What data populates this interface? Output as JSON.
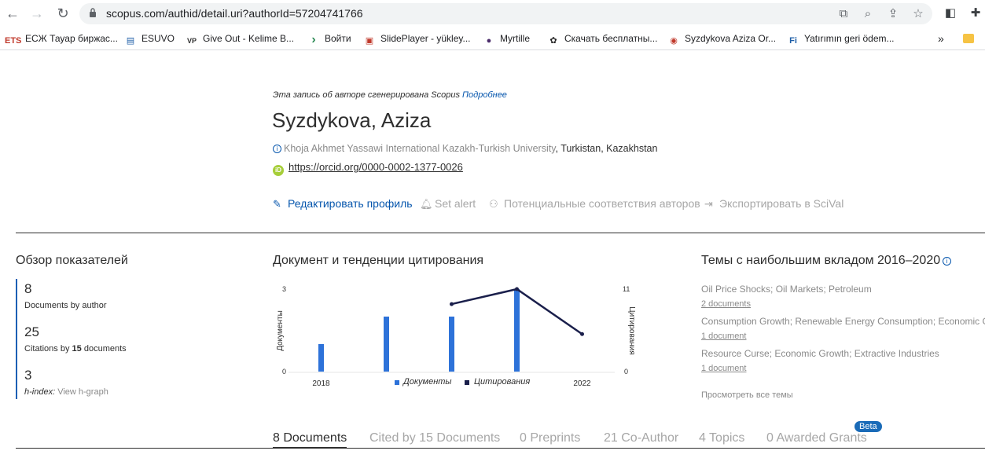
{
  "browser": {
    "url": "scopus.com/authid/detail.uri?authorId=57204741766",
    "bookmarks": [
      {
        "fav": "ETS",
        "label": "ЕСЖ Тауар биржас...",
        "color": "#c0392b"
      },
      {
        "fav": "▤",
        "label": "ESUVO",
        "color": "#1f5fa8"
      },
      {
        "fav": "VP",
        "label": "Give Out - Kelime B...",
        "color": "#333333"
      },
      {
        "fav": "›",
        "label": "Войти",
        "color": "#2e8b57"
      },
      {
        "fav": "▣",
        "label": "SlidePlayer - yükley...",
        "color": "#c0392b"
      },
      {
        "fav": "●",
        "label": "Myrtille",
        "color": "#4b2c6b"
      },
      {
        "fav": "✿",
        "label": "Скачать бесплатны...",
        "color": "#222222"
      },
      {
        "fav": "◉",
        "label": "Syzdykova Aziza Or...",
        "color": "#c0392b"
      },
      {
        "fav": "Fi",
        "label": "Yatırımın geri ödem...",
        "color": "#1f5fa8"
      }
    ],
    "more_label": "»"
  },
  "author": {
    "note_text": "Эта запись об авторе сгенерирована Scopus",
    "note_link": "Подробнее",
    "name": "Syzdykova, Aziza",
    "affiliation": "Khoja Akhmet Yassawi International Kazakh-Turkish University",
    "location": ", Turkistan, Kazakhstan",
    "orcid_url": "https://orcid.org/0000-0002-1377-0026"
  },
  "actions": {
    "edit_profile": "Редактировать профиль",
    "set_alert": "Set alert",
    "potential_matches": "Потенциальные соответствия авторов",
    "export_scival": "Экспортировать в SciVal"
  },
  "metrics": {
    "title": "Обзор показателей",
    "documents_value": "8",
    "documents_label": "Documents by author",
    "citations_value": "25",
    "citations_label_pre": "Citations by ",
    "citations_label_bold": "15",
    "citations_label_post": " documents",
    "hindex_value": "3",
    "hindex_label": "h-index:",
    "hindex_link": "View h-graph"
  },
  "chart_title": "Документ и тенденции цитирования",
  "chart_data": {
    "type": "bar",
    "x": [
      2018,
      2019,
      2020,
      2021,
      2022
    ],
    "x_tick_labels": [
      "2018",
      "2022"
    ],
    "series": [
      {
        "name": "Документы",
        "type": "bar",
        "axis": "left",
        "values": [
          1,
          2,
          2,
          3,
          0
        ],
        "color": "#2d72d9"
      },
      {
        "name": "Цитирования",
        "type": "line",
        "axis": "right",
        "values": [
          null,
          null,
          9,
          11,
          5
        ],
        "color": "#1a1f4b"
      }
    ],
    "left_axis": {
      "label": "Документы",
      "range": [
        0,
        3
      ],
      "ticks": [
        "0",
        "3"
      ]
    },
    "right_axis": {
      "label": "Цитирования",
      "range": [
        0,
        11
      ],
      "ticks": [
        "0",
        "11"
      ]
    },
    "legend_position": "bottom"
  },
  "topics": {
    "title": "Темы с наибольшим вкладом 2016–2020",
    "items": [
      {
        "name": "Oil Price Shocks; Oil Markets; Petroleum",
        "docs": "2 documents"
      },
      {
        "name": "Consumption Growth; Renewable Energy Consumption; Economic Gro",
        "docs": "1 document"
      },
      {
        "name": "Resource Curse; Economic Growth; Extractive Industries",
        "docs": "1 document"
      }
    ],
    "view_all": "Просмотреть все темы"
  },
  "tabs": [
    {
      "label": "8 Documents",
      "active": true
    },
    {
      "label": "Cited by 15 Documents",
      "active": false
    },
    {
      "label": "0 Preprints",
      "active": false
    },
    {
      "label": "21 Co-Author",
      "active": false
    },
    {
      "label": "4 Topics",
      "active": false
    },
    {
      "label": "0 Awarded Grants",
      "active": false
    }
  ],
  "beta_label": "Beta"
}
